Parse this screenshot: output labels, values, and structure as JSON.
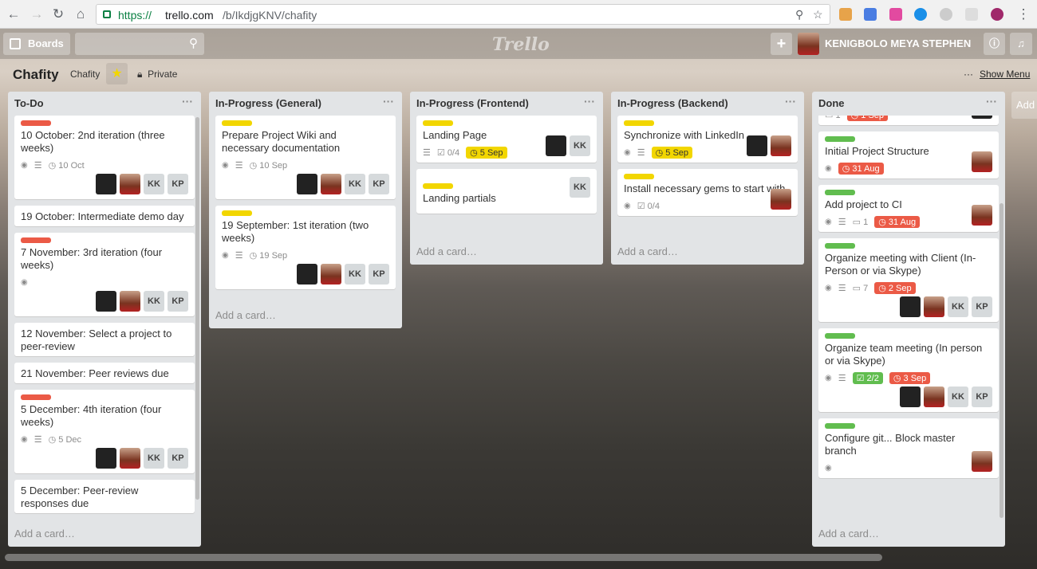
{
  "browser": {
    "url_scheme": "https://",
    "url_host": "trello.com",
    "url_path": "/b/IkdjgKNV/chafity"
  },
  "topbar": {
    "boards_label": "Boards",
    "logo": "Trello",
    "username": "KENIGBOLO MEYA STEPHEN"
  },
  "board": {
    "title": "Chafity",
    "team": "Chafity",
    "visibility": "Private",
    "menu_dots": "···",
    "menu_label": "Show Menu"
  },
  "add_card": "Add a card…",
  "add_list": "Add",
  "colors": {
    "red": "#eb5a46",
    "yellow": "#f2d600",
    "green": "#61bd4f",
    "due_red": "#eb5a46",
    "due_yellow": "#f2d600",
    "check_green": "#61bd4f"
  },
  "lists": [
    {
      "name": "To-Do",
      "cards": [
        {
          "label": "red",
          "title": "10 October: 2nd iteration (three weeks)",
          "badges": {
            "watch": true,
            "desc": true,
            "due": "10 Oct"
          },
          "members": [
            "black",
            "red",
            "KK",
            "KP"
          ]
        },
        {
          "title": "19 October: Intermediate demo day"
        },
        {
          "label": "red",
          "title": "7 November: 3rd iteration (four weeks)",
          "badges": {
            "watch": true
          },
          "members": [
            "black",
            "red",
            "KK",
            "KP"
          ]
        },
        {
          "title": "12 November: Select a project to peer-review"
        },
        {
          "title": "21 November: Peer reviews due"
        },
        {
          "label": "red",
          "title": "5 December: 4th iteration (four weeks)",
          "badges": {
            "watch": true,
            "desc": true,
            "due": "5 Dec"
          },
          "members": [
            "black",
            "red",
            "KK",
            "KP"
          ]
        },
        {
          "title": "5 December: Peer-review responses due"
        }
      ]
    },
    {
      "name": "In-Progress (General)",
      "cards": [
        {
          "label": "yellow",
          "title": "Prepare Project Wiki and necessary documentation",
          "badges": {
            "watch": true,
            "desc": true,
            "due": "10 Sep"
          },
          "members": [
            "black",
            "red",
            "KK",
            "KP"
          ]
        },
        {
          "label": "yellow",
          "title": "19 September: 1st iteration (two weeks)",
          "badges": {
            "watch": true,
            "desc": true,
            "due": "19 Sep"
          },
          "members": [
            "black",
            "red",
            "KK",
            "KP"
          ]
        }
      ]
    },
    {
      "name": "In-Progress (Frontend)",
      "cards": [
        {
          "label": "yellow",
          "title": "Landing Page",
          "badges": {
            "desc": true,
            "check": "0/4",
            "due_yellow": "5 Sep"
          },
          "members": [
            "black",
            "KK"
          ]
        },
        {
          "label": "yellow",
          "title": "Landing partials",
          "members": [
            "KK"
          ]
        }
      ]
    },
    {
      "name": "In-Progress (Backend)",
      "cards": [
        {
          "label": "yellow",
          "title": "Synchronize with LinkedIn",
          "badges": {
            "watch": true,
            "desc": true,
            "due_yellow": "5 Sep"
          },
          "members": [
            "black",
            "red"
          ]
        },
        {
          "label": "yellow",
          "title": "Install necessary gems to start with",
          "badges": {
            "watch": true,
            "check": "0/4"
          },
          "members": [
            "red"
          ]
        }
      ]
    },
    {
      "name": "Done",
      "cards": [
        {
          "partial": true,
          "badges": {
            "comments": "1",
            "due_red": "1 Sep"
          },
          "members": [
            "black"
          ]
        },
        {
          "label": "green",
          "title": "Initial Project Structure",
          "badges": {
            "watch": true,
            "due_red": "31 Aug"
          },
          "members": [
            "red"
          ]
        },
        {
          "label": "green",
          "title": "Add project to CI",
          "badges": {
            "watch": true,
            "desc": true,
            "comments": "1",
            "due_red": "31 Aug"
          },
          "members": [
            "red"
          ]
        },
        {
          "label": "green",
          "title": "Organize meeting with Client (In-Person or via Skype)",
          "badges": {
            "watch": true,
            "desc": true,
            "comments": "7",
            "due_red": "2 Sep"
          },
          "members": [
            "black",
            "red",
            "KK",
            "KP"
          ]
        },
        {
          "label": "green",
          "title": "Organize team meeting (In person or via Skype)",
          "badges": {
            "watch": true,
            "desc": true,
            "check_done": "2/2",
            "due_red": "3 Sep"
          },
          "members": [
            "black",
            "red",
            "KK",
            "KP"
          ]
        },
        {
          "label": "green",
          "title": "Configure git... Block master branch",
          "badges": {
            "watch": true
          },
          "members": [
            "red"
          ]
        }
      ]
    }
  ]
}
